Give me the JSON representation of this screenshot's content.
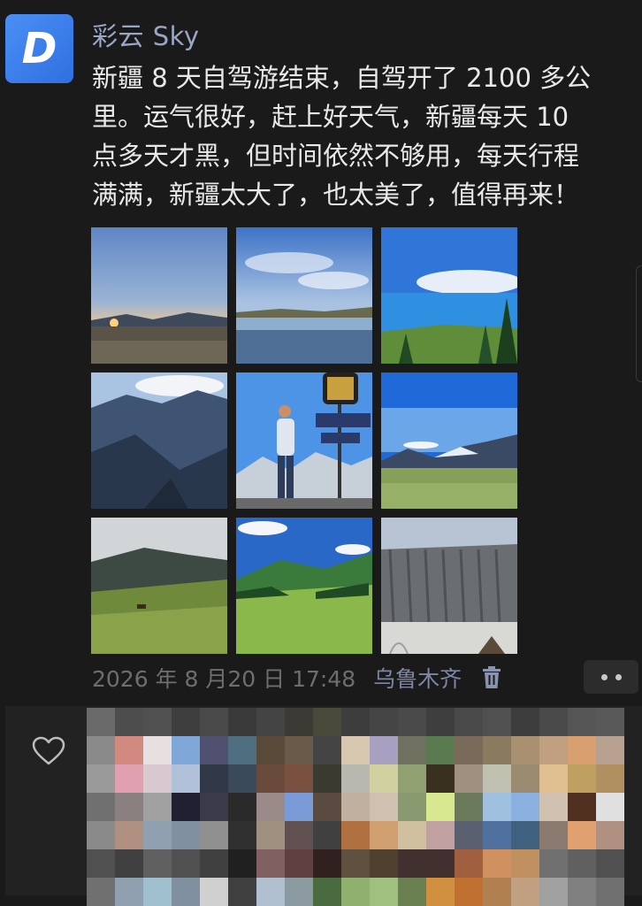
{
  "post": {
    "avatar_letter": "D",
    "username": "彩云 Sky",
    "text": "新疆 8 天自驾游结束，自驾开了 2100 多公\n里。运气很好，赶上好天气，新疆每天 10\n点多天才黑，但时间依然不够用，每天行程\n满满，新疆太大了，也太美了，值得再来！",
    "photos": [
      {
        "icon": "sunset-lake-photo"
      },
      {
        "icon": "lake-reflection-photo"
      },
      {
        "icon": "blue-lake-photo"
      },
      {
        "icon": "mountain-valley-photo"
      },
      {
        "icon": "person-sign-photo"
      },
      {
        "icon": "meadow-mountains-photo"
      },
      {
        "icon": "grassland-photo"
      },
      {
        "icon": "green-hills-photo"
      },
      {
        "icon": "canyon-photo"
      }
    ],
    "timestamp": "2026 年 8 月20 日 17:48",
    "location": "乌鲁木齐",
    "delete_icon": "trash-icon",
    "more_icon": "more-dots-icon"
  },
  "likes": {
    "heart_icon": "heart-icon",
    "mosaic_colors": [
      "#6a6a6a",
      "#4d4d4d",
      "#505050",
      "#3e3e3e",
      "#4a4a4a",
      "#3a3a3a",
      "#444444",
      "#3b3a35",
      "#4a4a3a",
      "#3d3d3d",
      "#454545",
      "#4a4a4a",
      "#3e3e3e",
      "#4a4a4a",
      "#505050",
      "#3d3d3d",
      "#4a4a4a",
      "#555555",
      "#595959",
      "#8a8a8a",
      "#d28a80",
      "#e8e0e0",
      "#7fa8d8",
      "#505070",
      "#4f6f80",
      "#5a4a3a",
      "#6a5a4a",
      "#444444",
      "#d8c8b0",
      "#a8a0c0",
      "#707060",
      "#5a7a50",
      "#7a6a5a",
      "#8a7a60",
      "#a89070",
      "#c0a080",
      "#d8a070",
      "#b8a090",
      "#9a9a9a",
      "#e0a0b0",
      "#d8c8d0",
      "#b0c0d8",
      "#303848",
      "#3a4a5a",
      "#6a4a3a",
      "#7a5040",
      "#3a3a30",
      "#b8b8b0",
      "#d0d0a0",
      "#90a070",
      "#3a3020",
      "#a09080",
      "#c0c0b0",
      "#9a8a70",
      "#e0c090",
      "#c0a060",
      "#b09060",
      "#707070",
      "#8a8080",
      "#a0a0a0",
      "#202030",
      "#3a3a48",
      "#2a2a2a",
      "#9a8a8a",
      "#7a9ad8",
      "#5a4a40",
      "#c0b0a0",
      "#d0c0b0",
      "#8a9a70",
      "#d8e890",
      "#6a7a5a",
      "#a0c0e0",
      "#8ab0e0",
      "#d0c0b0",
      "#503020",
      "#e0e0e0",
      "#8a8a8a",
      "#b09080",
      "#90a0b0",
      "#8090a0",
      "#909090",
      "#303030",
      "#a09080",
      "#605050",
      "#404040",
      "#b07040",
      "#d0a070",
      "#d0c0a0",
      "#c0a0a0",
      "#5a6070",
      "#5070a0",
      "#406080",
      "#8a7a70",
      "#e0a070",
      "#b09080",
      "#505050",
      "#404040",
      "#606060",
      "#505050",
      "#404040",
      "#202020",
      "#806060",
      "#604040",
      "#302020",
      "#605040",
      "#504030",
      "#403030",
      "#403030",
      "#a06040",
      "#d09060",
      "#c09060",
      "#707070",
      "#606060",
      "#505050",
      "#707070",
      "#90a0b0",
      "#a0c0d0",
      "#8090a0",
      "#d0d0d0",
      "#404040",
      "#b0c0d0",
      "#8a9aa0",
      "#4a6a40",
      "#90b070",
      "#a0c080",
      "#6a8050",
      "#d09040",
      "#c07030",
      "#b08050",
      "#c0a080",
      "#a0a0a0",
      "#808080",
      "#707070"
    ]
  }
}
